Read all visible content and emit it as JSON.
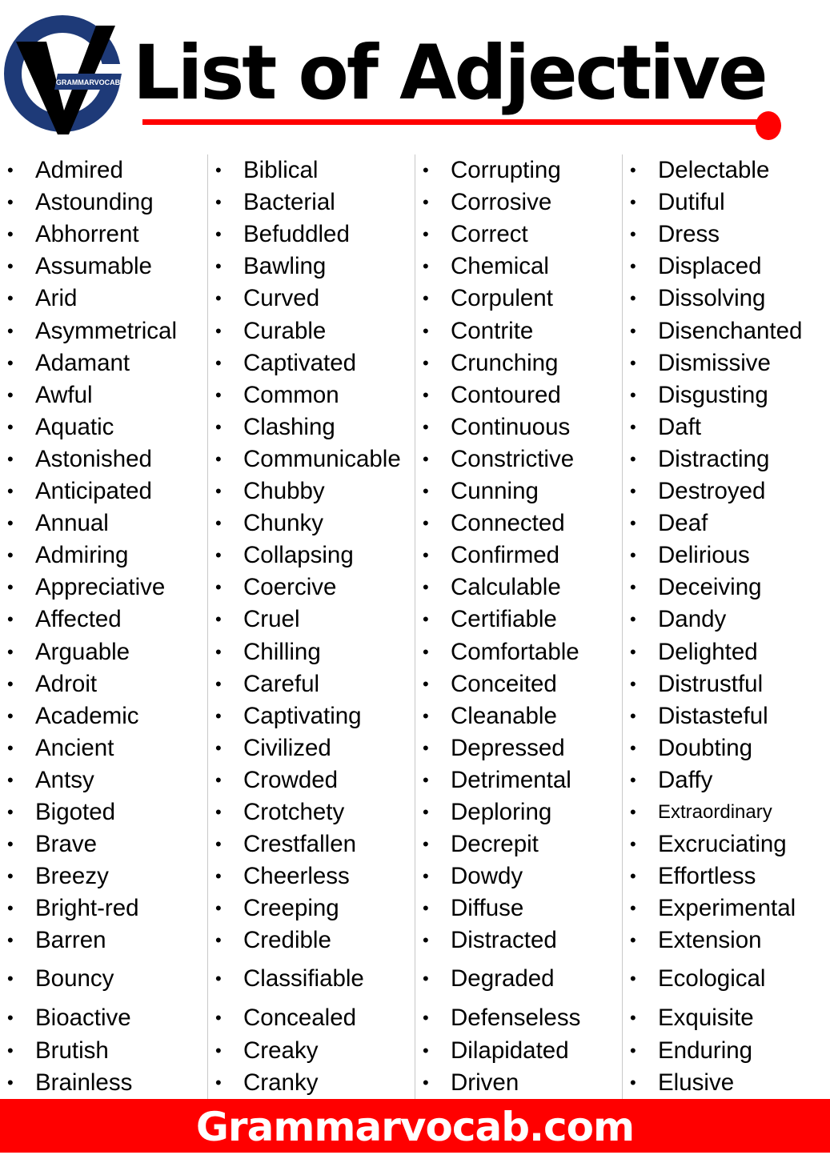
{
  "header": {
    "logo_text": "GRAMMARVOCAB",
    "title": "List of Adjective"
  },
  "colors": {
    "accent_red": "#ff0000",
    "logo_navy": "#1e3a78",
    "text": "#000000",
    "divider": "#c8c8c8"
  },
  "columns": [
    [
      "Admired",
      "Astounding",
      "Abhorrent",
      "Assumable",
      "Arid",
      "Asymmetrical",
      "Adamant",
      "Awful",
      "Aquatic",
      "Astonished",
      "Anticipated",
      "Annual",
      "Admiring",
      "Appreciative",
      "Affected",
      "Arguable",
      "Adroit",
      "Academic",
      "Ancient",
      "Antsy",
      "Bigoted",
      "Brave",
      "Breezy",
      "Bright-red",
      "Barren",
      "Bouncy",
      "Bioactive",
      "Brutish",
      "Brainless"
    ],
    [
      "Biblical",
      "Bacterial",
      "Befuddled",
      "Bawling",
      "Curved",
      "Curable",
      "Captivated",
      "Common",
      "Clashing",
      "Communicable",
      "Chubby",
      "Chunky",
      "Collapsing",
      "Coercive",
      "Cruel",
      "Chilling",
      "Careful",
      "Captivating",
      "Civilized",
      "Crowded",
      "Crotchety",
      "Crestfallen",
      "Cheerless",
      "Creeping",
      "Credible",
      "Classifiable",
      "Concealed",
      "Creaky",
      "Cranky"
    ],
    [
      "Corrupting",
      "Corrosive",
      "Correct",
      "Chemical",
      "Corpulent",
      "Contrite",
      "Crunching",
      "Contoured",
      "Continuous",
      "Constrictive",
      "Cunning",
      "Connected",
      "Confirmed",
      "Calculable",
      "Certifiable",
      "Comfortable",
      "Conceited",
      "Cleanable",
      "Depressed",
      "Detrimental",
      "Deploring",
      "Decrepit",
      "Dowdy",
      "Diffuse",
      "Distracted",
      "Degraded",
      "Defenseless",
      "Dilapidated",
      "Driven"
    ],
    [
      "Delectable",
      "Dutiful",
      "Dress",
      "Displaced",
      "Dissolving",
      "Disenchanted",
      "Dismissive",
      "Disgusting",
      "Daft",
      "Distracting",
      "Destroyed",
      "Deaf",
      "Delirious",
      "Deceiving",
      "Dandy",
      "Delighted",
      "Distrustful",
      "Distasteful",
      "Doubting",
      "Daffy",
      "Extraordinary",
      "Excruciating",
      "Effortless",
      "Experimental",
      "Extension",
      "Ecological",
      "Exquisite",
      "Enduring",
      "Elusive"
    ]
  ],
  "bullet_symbol": "•",
  "footer": {
    "site": "Grammarvocab.com"
  }
}
